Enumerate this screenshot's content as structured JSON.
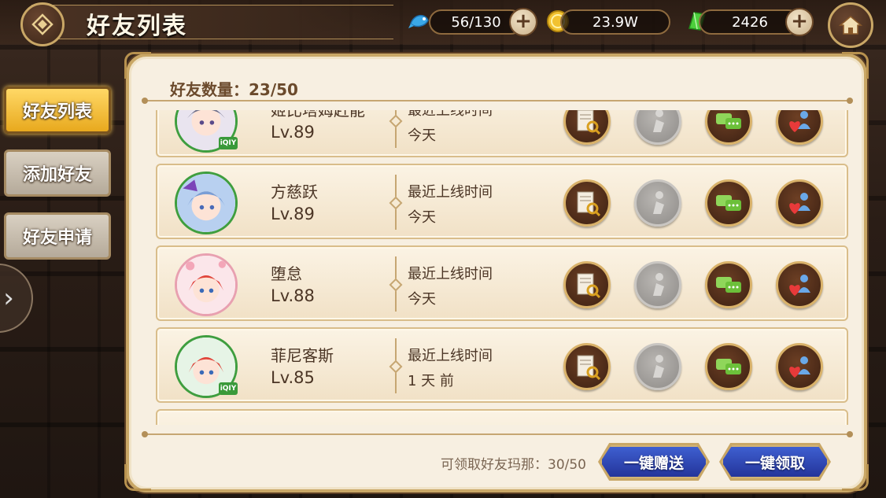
{
  "header": {
    "title": "好友列表",
    "stamina": "56/130",
    "gold": "23.9W",
    "gems": "2426"
  },
  "sidebar": {
    "tabs": [
      {
        "label": "好友列表",
        "active": true
      },
      {
        "label": "添加好友",
        "active": false
      },
      {
        "label": "好友申请",
        "active": false
      }
    ]
  },
  "panel": {
    "friend_count": "好友数量：23/50"
  },
  "friends": [
    {
      "name": "姬比塔姆赶能",
      "level": "Lv.89",
      "online_label": "最近上线时间",
      "online_value": "今天",
      "badge": "iQIY"
    },
    {
      "name": "方慈跃",
      "level": "Lv.89",
      "online_label": "最近上线时间",
      "online_value": "今天",
      "badge": ""
    },
    {
      "name": "堕怠",
      "level": "Lv.88",
      "online_label": "最近上线时间",
      "online_value": "今天",
      "badge": ""
    },
    {
      "name": "菲尼客斯",
      "level": "Lv.85",
      "online_label": "最近上线时间",
      "online_value": "1 天 前",
      "badge": "iQIY"
    }
  ],
  "footer": {
    "claim_text": "可领取好友玛那：30/50",
    "send_all": "一键赠送",
    "claim_all": "一键领取"
  },
  "colors": {
    "accent_gold": "#c9a766",
    "panel_bg": "#f7efe1",
    "button_blue": "#2e48b8",
    "tab_active": "#f0b830"
  }
}
